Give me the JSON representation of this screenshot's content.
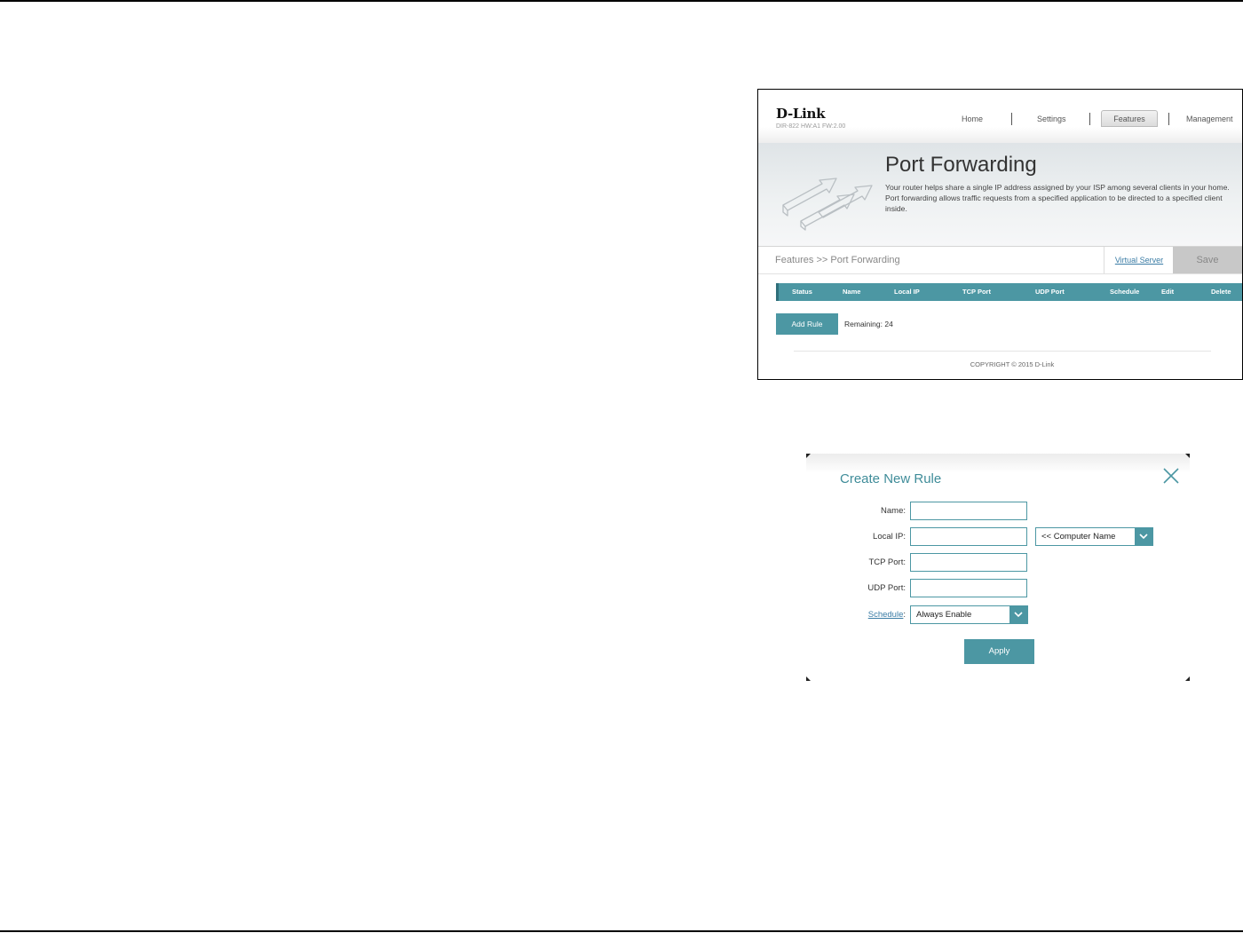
{
  "router": {
    "brand": "D-Link",
    "model": "DIR-822 HW:A1 FW:2.00",
    "nav": [
      "Home",
      "Settings",
      "Features",
      "Management"
    ],
    "active_nav": "Features",
    "page_title": "Port Forwarding",
    "description": "Your router helps share a single IP address assigned by your ISP among several clients in your home. Port forwarding allows traffic requests from a specified application to be directed to a specified client inside.",
    "breadcrumb": "Features >> Port Forwarding",
    "virtual_server_link": "Virtual Server",
    "save_label": "Save",
    "table_headers": [
      "Status",
      "Name",
      "Local IP",
      "TCP Port",
      "UDP Port",
      "Schedule",
      "Edit",
      "Delete"
    ],
    "add_rule_label": "Add Rule",
    "remaining_text": "Remaining: 24",
    "copyright": "COPYRIGHT © 2015 D-Link",
    "colors": {
      "accent": "#4c97a3",
      "save_disabled": "#c8c8c8"
    }
  },
  "dialog": {
    "title": "Create New Rule",
    "close_icon": "close-icon",
    "fields": {
      "name_label": "Name:",
      "name_value": "",
      "local_ip_label": "Local IP:",
      "local_ip_value": "",
      "computer_name_select": "<< Computer Name",
      "tcp_port_label": "TCP Port:",
      "tcp_port_value": "",
      "udp_port_label": "UDP Port:",
      "udp_port_value": "",
      "schedule_label": "Schedule",
      "schedule_select": "Always Enable"
    },
    "apply_label": "Apply"
  }
}
